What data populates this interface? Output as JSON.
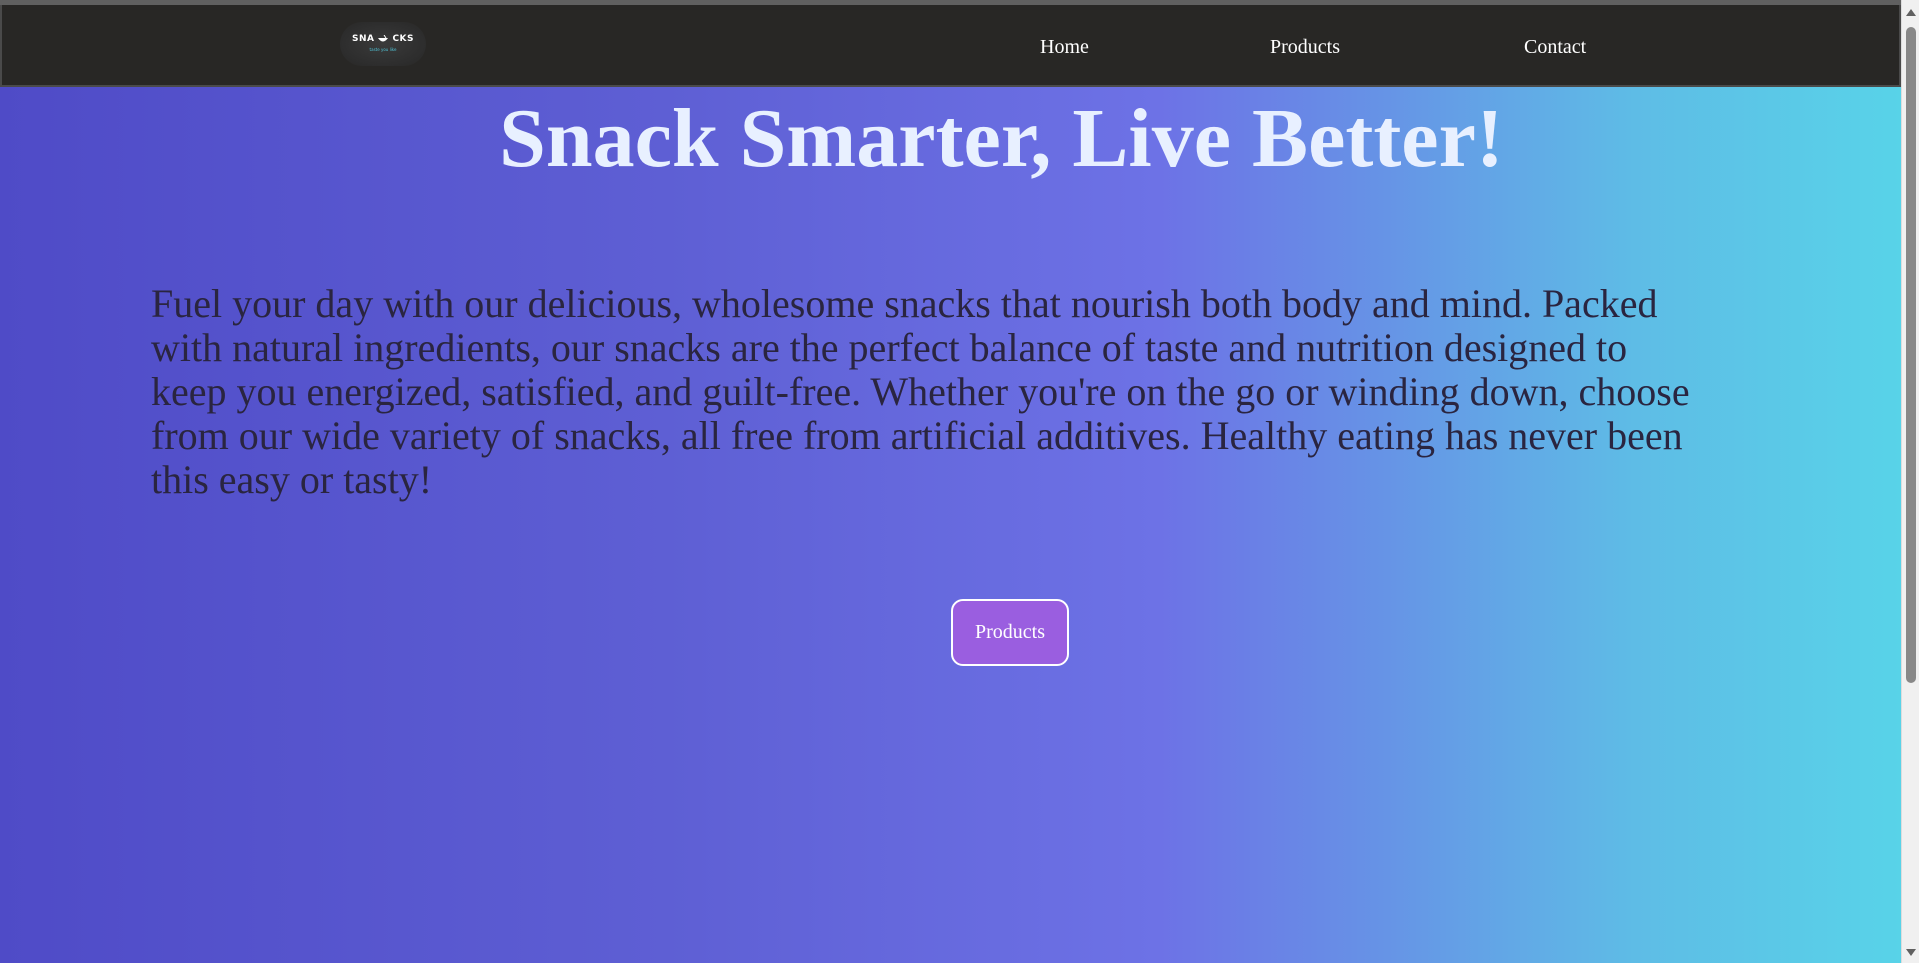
{
  "navbar": {
    "logo": {
      "text_left": "SNA",
      "text_right": "CKS",
      "tagline": "taste you like",
      "icon": "bowl-icon"
    },
    "links": {
      "home": "Home",
      "products": "Products",
      "contact": "Contact"
    }
  },
  "hero": {
    "title": "Snack Smarter, Live Better!",
    "description": "Fuel your day with our delicious, wholesome snacks that nourish both body and mind. Packed with natural ingredients, our snacks are the perfect balance of taste and nutrition designed to keep you energized, satisfied, and guilt-free. Whether you're on the go or winding down, choose from our wide variety of snacks, all free from artificial additives. Healthy eating has never been this easy or tasty!",
    "button_label": "Products"
  },
  "colors": {
    "navbar_bg": "#282725",
    "gradient_start": "#4f4bc7",
    "gradient_mid": "#6d72e6",
    "gradient_end": "#58d3e8",
    "title_color": "#e8f0ff",
    "button_bg": "#9a5ee0",
    "logo_tagline": "#4fc3d6"
  }
}
